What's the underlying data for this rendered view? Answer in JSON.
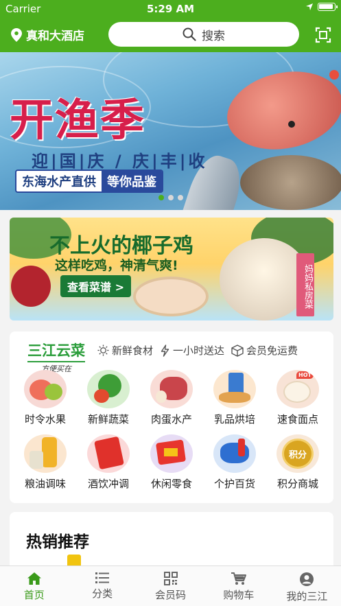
{
  "status_bar": {
    "carrier": "Carrier",
    "time": "5:29 AM"
  },
  "header": {
    "location": "真和大酒店",
    "search_placeholder": "搜索"
  },
  "banner": {
    "title": "开渔季",
    "subtitle": "迎|国|庆 / 庆|丰|收",
    "tag_left": "东海水产直供",
    "tag_right": "等你品鉴",
    "dots": 3,
    "active_dot": 0
  },
  "promo": {
    "title": "不上火的椰子鸡",
    "subtitle": "这样吃鸡，神清气爽!",
    "button": "查看菜谱 >",
    "vertical_tag": "妈妈私房菜"
  },
  "store": {
    "brand_name": "三江云菜",
    "brand_slogan": "方便买在",
    "features": [
      "新鲜食材",
      "一小时送达",
      "会员免运费"
    ],
    "categories": [
      {
        "label": "时令水果",
        "icon": "fruit-icon",
        "color": "#f7d9d5"
      },
      {
        "label": "新鲜蔬菜",
        "icon": "vegetable-icon",
        "color": "#d8efd0"
      },
      {
        "label": "肉蛋水产",
        "icon": "meat-icon",
        "color": "#f9dcd6"
      },
      {
        "label": "乳品烘培",
        "icon": "dairy-icon",
        "color": "#fce7cf"
      },
      {
        "label": "速食面点",
        "icon": "dumpling-icon",
        "color": "#f8e3d6",
        "badge": "HOT"
      },
      {
        "label": "粮油调味",
        "icon": "oil-icon",
        "color": "#fbe6cf"
      },
      {
        "label": "酒饮冲调",
        "icon": "drink-icon",
        "color": "#fbd9d9"
      },
      {
        "label": "休闲零食",
        "icon": "snack-icon",
        "color": "#e7dcf5"
      },
      {
        "label": "个护百货",
        "icon": "personal-care-icon",
        "color": "#d8e6f8"
      },
      {
        "label": "积分商城",
        "icon": "points-icon",
        "color": "#f8e8d8",
        "badge_text": "积分"
      }
    ]
  },
  "hot_section": {
    "title": "热销推荐"
  },
  "tabbar": {
    "items": [
      {
        "label": "首页",
        "icon": "home-icon",
        "active": true
      },
      {
        "label": "分类",
        "icon": "list-icon",
        "active": false
      },
      {
        "label": "会员码",
        "icon": "qr-code-icon",
        "active": false
      },
      {
        "label": "购物车",
        "icon": "cart-icon",
        "active": false
      },
      {
        "label": "我的三江",
        "icon": "user-icon",
        "active": false
      }
    ]
  },
  "colors": {
    "brand_green": "#4cae1e",
    "active_tab": "#3a9a1a"
  }
}
